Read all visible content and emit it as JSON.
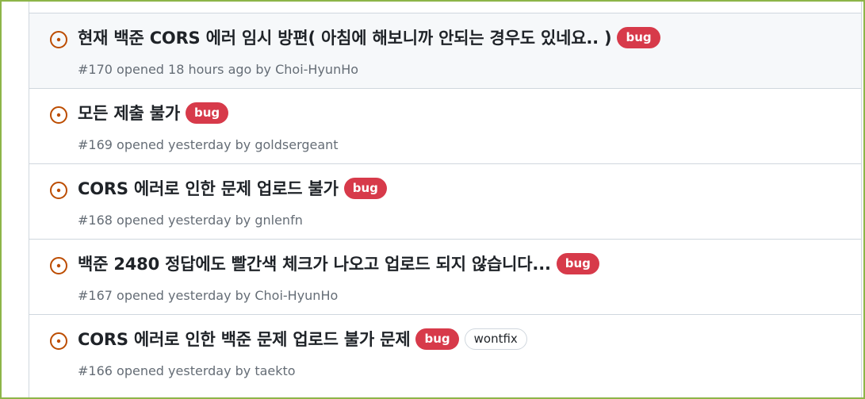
{
  "issues": [
    {
      "title": "현재 백준 CORS 에러 임시 방편( 아침에 해보니까 안되는 경우도 있네요.. )",
      "meta": "#170 opened 18 hours ago by Choi-HyunHo",
      "labels": [
        {
          "name": "bug",
          "kind": "bug"
        }
      ]
    },
    {
      "title": "모든 제출 불가",
      "meta": "#169 opened yesterday by goldsergeant",
      "labels": [
        {
          "name": "bug",
          "kind": "bug"
        }
      ]
    },
    {
      "title": "CORS 에러로 인한 문제 업로드 불가",
      "meta": "#168 opened yesterday by gnlenfn",
      "labels": [
        {
          "name": "bug",
          "kind": "bug"
        }
      ]
    },
    {
      "title": "백준 2480 정답에도 빨간색 체크가 나오고 업로드 되지 않습니다...",
      "meta": "#167 opened yesterday by Choi-HyunHo",
      "labels": [
        {
          "name": "bug",
          "kind": "bug"
        }
      ]
    },
    {
      "title": "CORS 에러로 인한 백준 문제 업로드 불가 문제",
      "meta": "#166 opened yesterday by taekto",
      "labels": [
        {
          "name": "bug",
          "kind": "bug"
        },
        {
          "name": "wontfix",
          "kind": "wontfix"
        }
      ]
    }
  ],
  "colors": {
    "open_icon": "#bc4c00",
    "bug_label": "#d73a4a",
    "frame": "#8db549",
    "hover_row": "#f6f8fa"
  },
  "icons": {
    "open": "issue-opened-icon"
  }
}
